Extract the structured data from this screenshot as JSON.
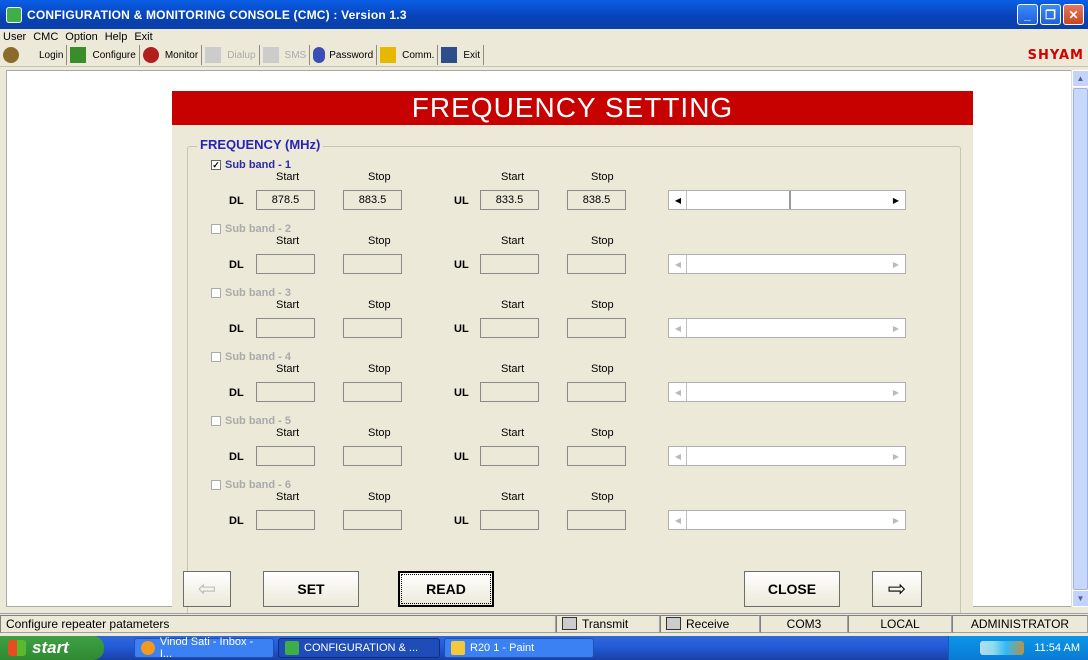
{
  "window": {
    "title": "CONFIGURATION & MONITORING CONSOLE (CMC) : Version 1.3",
    "minimize": "_",
    "maximize": "❐",
    "close": "✕"
  },
  "menu": [
    "User",
    "CMC",
    "Option",
    "Help",
    "Exit"
  ],
  "toolbar": {
    "login": "Login",
    "configure": "Configure",
    "monitor": "Monitor",
    "dialup": "Dialup",
    "sms": "SMS",
    "password": "Password",
    "comm": "Comm.",
    "exit": "Exit",
    "brand": "SHYAM"
  },
  "panel": {
    "header": "FREQUENCY SETTING",
    "group_title": "FREQUENCY (MHz)",
    "start_label": "Start",
    "stop_label": "Stop",
    "dl_label": "DL",
    "ul_label": "UL",
    "subbands": [
      {
        "label": "Sub band - 1",
        "checked": true,
        "enabled": true,
        "dl_start": "878.5",
        "dl_stop": "883.5",
        "ul_start": "833.5",
        "ul_stop": "838.5"
      },
      {
        "label": "Sub band - 2",
        "checked": false,
        "enabled": false,
        "dl_start": "",
        "dl_stop": "",
        "ul_start": "",
        "ul_stop": ""
      },
      {
        "label": "Sub band - 3",
        "checked": false,
        "enabled": false,
        "dl_start": "",
        "dl_stop": "",
        "ul_start": "",
        "ul_stop": ""
      },
      {
        "label": "Sub band - 4",
        "checked": false,
        "enabled": false,
        "dl_start": "",
        "dl_stop": "",
        "ul_start": "",
        "ul_stop": ""
      },
      {
        "label": "Sub band - 5",
        "checked": false,
        "enabled": false,
        "dl_start": "",
        "dl_stop": "",
        "ul_start": "",
        "ul_stop": ""
      },
      {
        "label": "Sub band - 6",
        "checked": false,
        "enabled": false,
        "dl_start": "",
        "dl_stop": "",
        "ul_start": "",
        "ul_stop": ""
      }
    ],
    "buttons": {
      "set": "SET",
      "read": "READ",
      "close": "CLOSE",
      "prev_arrow": "⇦",
      "next_arrow": "⇨"
    }
  },
  "status": {
    "message": "Configure repeater patameters",
    "transmit": "Transmit",
    "receive": "Receive",
    "port": "COM3",
    "mode": "LOCAL",
    "user": "ADMINISTRATOR"
  },
  "taskbar": {
    "start": "start",
    "tasks": [
      "Vinod Sati - Inbox - I...",
      "CONFIGURATION & ...",
      "R20 1 - Paint"
    ],
    "clock": "11:54 AM"
  }
}
